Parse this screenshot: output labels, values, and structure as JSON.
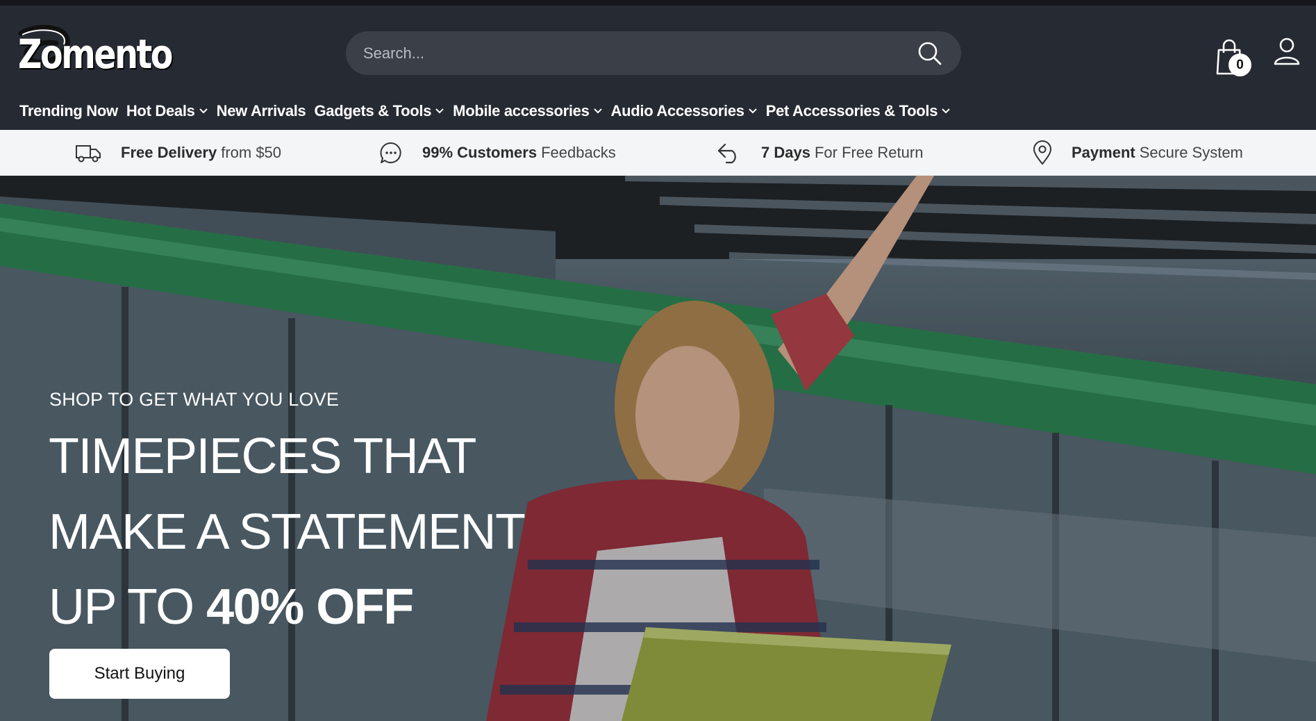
{
  "brand": {
    "name": "Zomento"
  },
  "search": {
    "placeholder": "Search..."
  },
  "cart": {
    "count": "0"
  },
  "nav": {
    "items": [
      {
        "label": "Trending Now",
        "dropdown": false
      },
      {
        "label": "Hot Deals",
        "dropdown": true
      },
      {
        "label": "New Arrivals",
        "dropdown": false
      },
      {
        "label": "Gadgets & Tools",
        "dropdown": true
      },
      {
        "label": "Mobile accessories",
        "dropdown": true
      },
      {
        "label": "Audio Accessories",
        "dropdown": true
      },
      {
        "label": "Pet Accessories & Tools",
        "dropdown": true
      }
    ]
  },
  "features": [
    {
      "icon": "truck-icon",
      "bold": "Free Delivery",
      "text": "from $50"
    },
    {
      "icon": "chat-icon",
      "bold": "99% Customers",
      "text": "Feedbacks"
    },
    {
      "icon": "return-arrow-icon",
      "bold": "7 Days",
      "text": "For Free Return"
    },
    {
      "icon": "location-pin-icon",
      "bold": "Payment",
      "text": "Secure System"
    }
  ],
  "hero": {
    "eyebrow": "SHOP TO GET WHAT YOU LOVE",
    "line1": "TIMEPIECES THAT",
    "line2": "MAKE A STATEMENT",
    "line3_prefix": "UP TO ",
    "line3_strong": "40% OFF",
    "cta": "Start Buying"
  },
  "colors": {
    "header_bg": "#262a33",
    "search_bg": "#3b3f48",
    "feature_bar_bg": "#f4f5f6",
    "hero_accent_green": "#2f8a57"
  }
}
